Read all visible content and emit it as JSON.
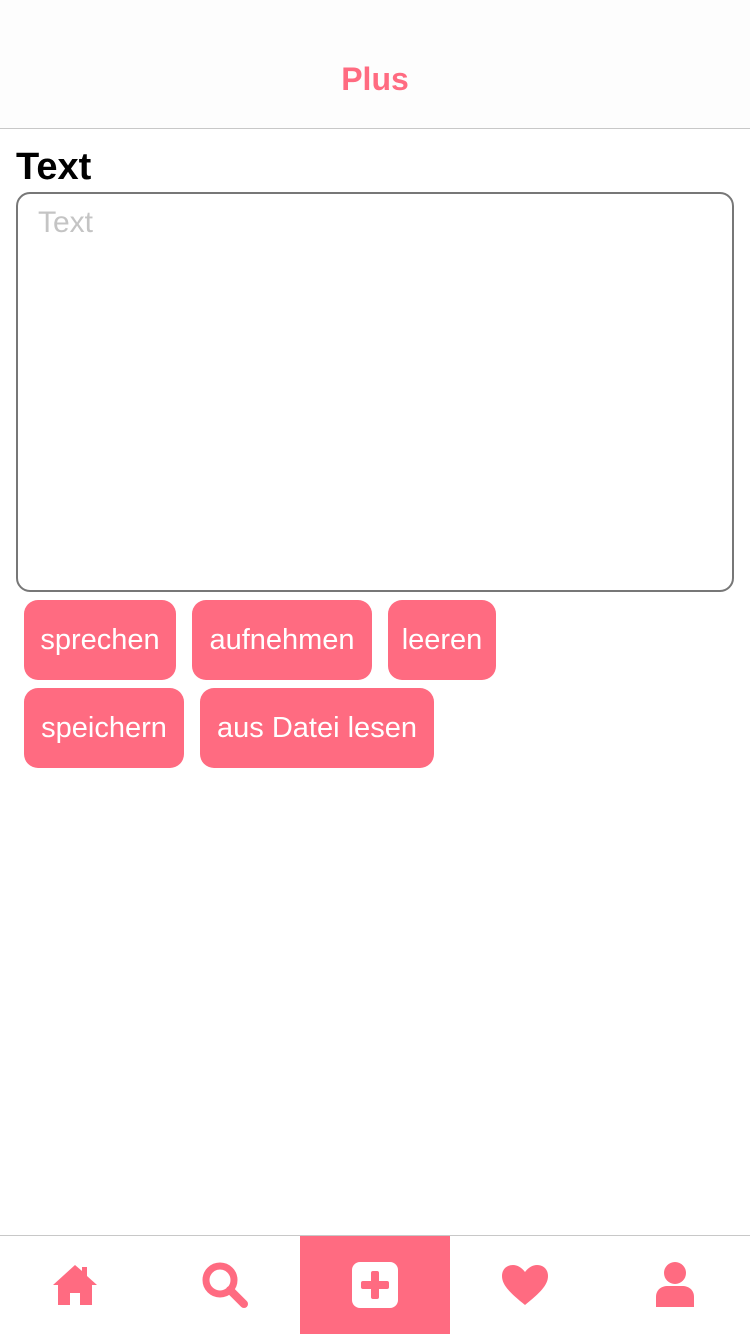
{
  "header": {
    "title": "Plus"
  },
  "form": {
    "label": "Text",
    "textarea_placeholder": "Text",
    "textarea_value": ""
  },
  "buttons": {
    "speak": "sprechen",
    "record": "aufnehmen",
    "clear": "leeren",
    "save": "speichern",
    "read_file": "aus Datei lesen"
  },
  "tabbar": {
    "items": [
      {
        "icon": "home-icon",
        "active": false
      },
      {
        "icon": "search-icon",
        "active": false
      },
      {
        "icon": "plus-square-icon",
        "active": true
      },
      {
        "icon": "heart-icon",
        "active": false
      },
      {
        "icon": "user-icon",
        "active": false
      }
    ]
  },
  "colors": {
    "accent": "#ff6b81",
    "border": "#c8c8c8",
    "placeholder": "#c4c4c4"
  }
}
